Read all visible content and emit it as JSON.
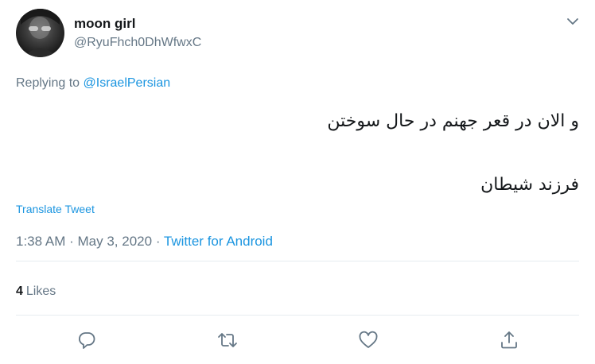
{
  "author": {
    "display_name": "moon girl",
    "handle": "@RyuFhch0DhWfwxC"
  },
  "reply": {
    "prefix": "Replying to",
    "mention": "@IsraelPersian"
  },
  "tweet": {
    "line1": "و الان در قعر جهنم در حال سوختن",
    "line2": "فرزند شیطان"
  },
  "translate_label": "Translate Tweet",
  "meta": {
    "time": "1:38 AM",
    "date": "May 3, 2020",
    "separator": "·",
    "source": "Twitter for Android"
  },
  "stats": {
    "likes_count": "4",
    "likes_label": "Likes"
  },
  "colors": {
    "link": "#1b95e0",
    "secondary_text": "#657786",
    "divider": "#e6ecf0"
  },
  "icons": {
    "caret": "chevron-down-icon",
    "reply": "reply-icon",
    "retweet": "retweet-icon",
    "like": "heart-icon",
    "share": "share-icon"
  }
}
